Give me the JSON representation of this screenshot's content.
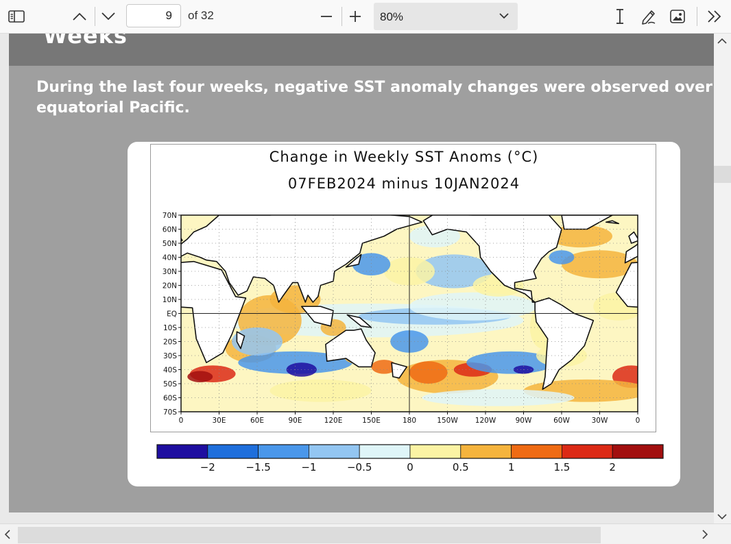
{
  "toolbar": {
    "page_number": "9",
    "page_total": "of 32",
    "zoom": "80%",
    "icons": [
      "sidebar-toggle-icon",
      "chevron-up-icon",
      "chevron-down-icon",
      "zoom-out-icon",
      "zoom-in-icon",
      "text-cursor-icon",
      "draw-pen-icon",
      "image-icon",
      "more-tools-icon"
    ]
  },
  "slide": {
    "title_fragment": "Weeks",
    "text_line1": "During the last four weeks, negative SST anomaly changes were observed over mo",
    "text_line2": "equatorial Pacific."
  },
  "figure": {
    "title": "Change in Weekly SST Anoms (°C)",
    "subtitle": "07FEB2024 minus 10JAN2024",
    "lat_labels": [
      "70N",
      "60N",
      "50N",
      "40N",
      "30N",
      "20N",
      "10N",
      "EQ",
      "10S",
      "20S",
      "30S",
      "40S",
      "50S",
      "60S",
      "70S"
    ],
    "lon_labels": [
      "0",
      "30E",
      "60E",
      "90E",
      "120E",
      "150E",
      "180",
      "150W",
      "120W",
      "90W",
      "60W",
      "30W",
      "0"
    ],
    "colorbar": {
      "colors": [
        "#1e0ea0",
        "#1f6fdc",
        "#4a97ea",
        "#93c6f2",
        "#dff5f8",
        "#fbf3a4",
        "#f5b43d",
        "#ef6b14",
        "#dc2a16",
        "#a20f0f"
      ],
      "tick_labels": [
        "−2",
        "−1.5",
        "−1",
        "−0.5",
        "0",
        "0.5",
        "1",
        "1.5",
        "2"
      ]
    }
  }
}
